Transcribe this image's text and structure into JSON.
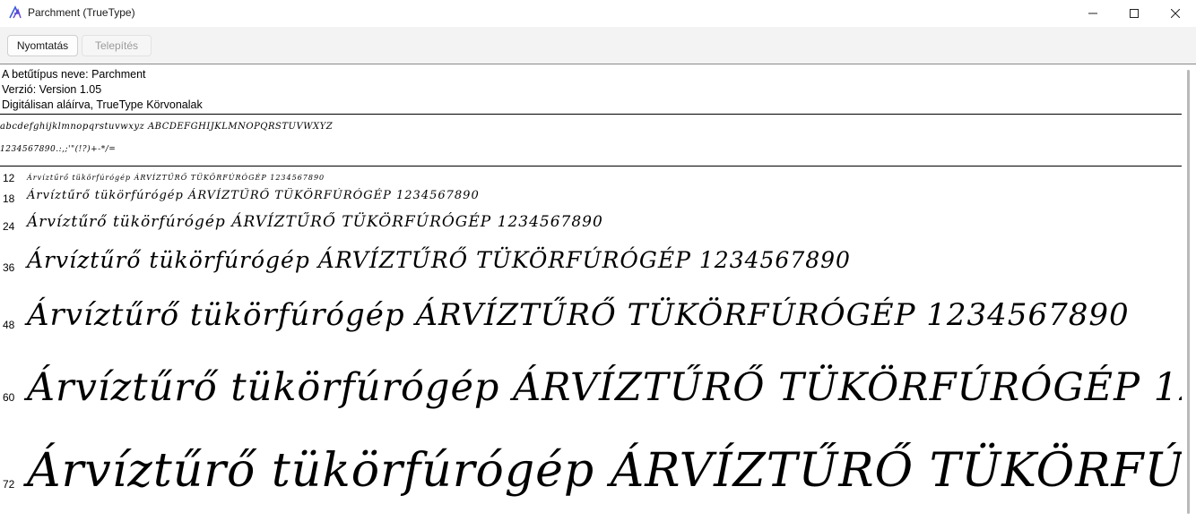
{
  "window": {
    "title": "Parchment (TrueType)"
  },
  "toolbar": {
    "print_label": "Nyomtatás",
    "install_label": "Telepítés"
  },
  "info": {
    "name_line": "A betűtípus neve: Parchment",
    "version_line": "Verzió: Version 1.05",
    "signature_line": "Digitálisan aláírva, TrueType Körvonalak"
  },
  "charset": {
    "line1": "abcdefghijklmnopqrstuvwxyz ABCDEFGHIJKLMNOPQRSTUVWXYZ",
    "line2": "1234567890.:,;'\"(!?)+-*/="
  },
  "sample_text": "Árvíztűrő tükörfúrógép ÁRVÍZTŰRŐ TÜKÖRFÚRÓGÉP 1234567890",
  "samples": [
    {
      "size_label": "12"
    },
    {
      "size_label": "18"
    },
    {
      "size_label": "24"
    },
    {
      "size_label": "36"
    },
    {
      "size_label": "48"
    },
    {
      "size_label": "60"
    },
    {
      "size_label": "72"
    }
  ]
}
